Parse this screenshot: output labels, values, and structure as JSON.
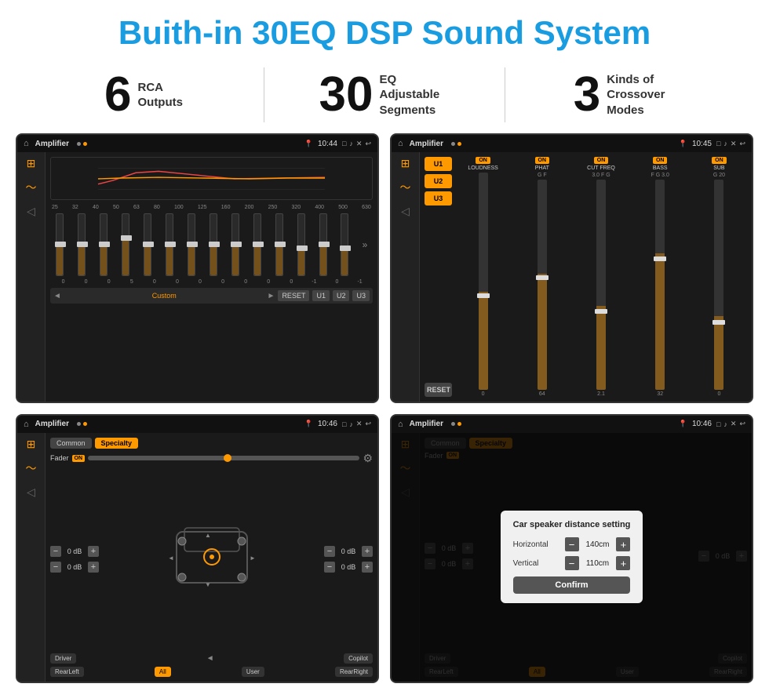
{
  "header": {
    "title": "Buith-in 30EQ DSP Sound System"
  },
  "stats": [
    {
      "number": "6",
      "desc": "RCA\nOutputs"
    },
    {
      "number": "30",
      "desc": "EQ Adjustable\nSegments"
    },
    {
      "number": "3",
      "desc": "Kinds of\nCrossover Modes"
    }
  ],
  "screens": [
    {
      "id": "screen1",
      "label": "EQ Screen",
      "status": {
        "title": "Amplifier",
        "time": "10:44"
      },
      "eq_freqs": [
        "25",
        "32",
        "40",
        "50",
        "63",
        "80",
        "100",
        "125",
        "160",
        "200",
        "250",
        "320",
        "400",
        "500",
        "630"
      ],
      "eq_values": [
        "0",
        "0",
        "0",
        "5",
        "0",
        "0",
        "0",
        "0",
        "0",
        "0",
        "0",
        "-1",
        "0",
        "-1"
      ],
      "preset_label": "Custom",
      "buttons": [
        "RESET",
        "U1",
        "U2",
        "U3"
      ]
    },
    {
      "id": "screen2",
      "label": "Amplifier Screen 2",
      "status": {
        "title": "Amplifier",
        "time": "10:45"
      },
      "presets": [
        "U1",
        "U2",
        "U3"
      ],
      "channels": [
        {
          "name": "LOUDNESS",
          "on": true
        },
        {
          "name": "PHAT",
          "on": true
        },
        {
          "name": "CUT FREQ",
          "on": true
        },
        {
          "name": "BASS",
          "on": true
        },
        {
          "name": "SUB",
          "on": true
        }
      ],
      "reset_label": "RESET"
    },
    {
      "id": "screen3",
      "label": "Speaker Screen",
      "status": {
        "title": "Amplifier",
        "time": "10:46"
      },
      "tabs": [
        "Common",
        "Specialty"
      ],
      "fader_label": "Fader",
      "fader_on": "ON",
      "db_values": [
        "0 dB",
        "0 dB",
        "0 dB",
        "0 dB"
      ],
      "bottom_buttons": [
        "Driver",
        "",
        "Copilot",
        "RearLeft",
        "All",
        "User",
        "RearRight"
      ]
    },
    {
      "id": "screen4",
      "label": "Distance Setting Screen",
      "status": {
        "title": "Amplifier",
        "time": "10:46"
      },
      "tabs": [
        "Common",
        "Specialty"
      ],
      "dialog": {
        "title": "Car speaker distance setting",
        "horizontal_label": "Horizontal",
        "horizontal_value": "140cm",
        "vertical_label": "Vertical",
        "vertical_value": "110cm",
        "confirm_label": "Confirm"
      },
      "db_values": [
        "0 dB",
        "0 dB"
      ],
      "bottom_buttons": [
        "Driver",
        "Copilot",
        "RearLeft",
        "User",
        "RearRight"
      ]
    }
  ]
}
